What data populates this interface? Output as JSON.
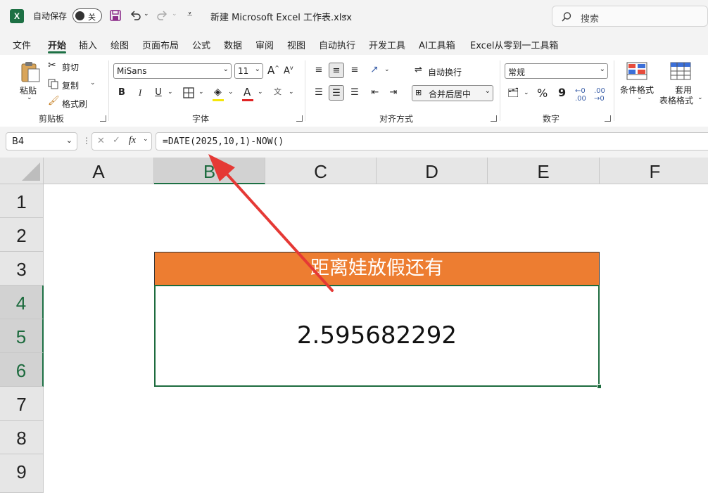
{
  "titlebar": {
    "autosave_label": "自动保存",
    "autosave_state": "关",
    "filename": "新建 Microsoft Excel 工作表.xlsx",
    "search_placeholder": "搜索"
  },
  "menu": {
    "tabs": [
      "文件",
      "开始",
      "插入",
      "绘图",
      "页面布局",
      "公式",
      "数据",
      "审阅",
      "视图",
      "自动执行",
      "开发工具",
      "AI工具箱",
      "Excel从零到一工具箱"
    ],
    "active": "开始"
  },
  "ribbon": {
    "clipboard": {
      "paste": "粘贴",
      "cut": "剪切",
      "copy": "复制",
      "format_painter": "格式刷",
      "group_label": "剪贴板"
    },
    "font": {
      "font_name": "MiSans",
      "font_size": "11",
      "bold": "B",
      "italic": "I",
      "underline": "U",
      "group_label": "字体"
    },
    "alignment": {
      "wrap_text": "自动换行",
      "merge_center": "合并后居中",
      "group_label": "对齐方式"
    },
    "number": {
      "format": "常规",
      "percent": "%",
      "comma": "9",
      "group_label": "数字"
    },
    "styles": {
      "conditional": "条件格式",
      "table_line1": "套用",
      "table_line2": "表格格式"
    }
  },
  "formula_bar": {
    "name_box": "B4",
    "formula": "=DATE(2025,10,1)-NOW()"
  },
  "grid": {
    "columns": [
      "A",
      "B",
      "C",
      "D",
      "E",
      "F"
    ],
    "rows": [
      "1",
      "2",
      "3",
      "4",
      "5",
      "6",
      "7",
      "8",
      "9"
    ],
    "selected_column": "B",
    "selected_rows": [
      "4",
      "5",
      "6"
    ],
    "title_cell_text": "距离娃放假还有",
    "value_cell_text": "2.595682292"
  },
  "colors": {
    "excel_green": "#1d7044",
    "title_fill": "#ed7d31",
    "annotation_arrow": "#e53935"
  }
}
